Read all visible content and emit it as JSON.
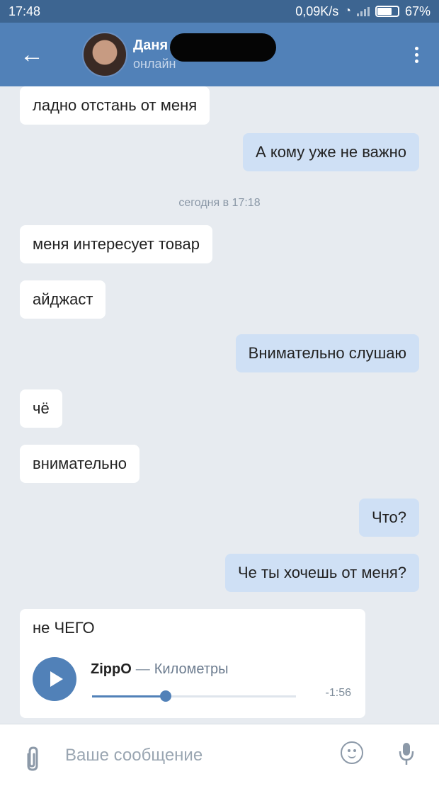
{
  "status_bar": {
    "time": "17:48",
    "network_speed": "0,09K/s",
    "battery_percent": "67%",
    "battery_level": 0.67
  },
  "header": {
    "contact_name": "Даня",
    "contact_status": "онлайн",
    "icons": {
      "back": "back-arrow-icon",
      "menu": "more-vertical-icon"
    }
  },
  "messages": [
    {
      "from": "them",
      "text": "ладно отстань от меня"
    },
    {
      "from": "me",
      "text": "А кому уже не важно"
    },
    {
      "type": "date",
      "text": "сегодня в 17:18"
    },
    {
      "from": "them",
      "text": "меня интересует товар"
    },
    {
      "from": "them",
      "text": "айджаст"
    },
    {
      "from": "me",
      "text": "Внимательно слушаю"
    },
    {
      "from": "them",
      "text": "чё"
    },
    {
      "from": "them",
      "text": "внимательно"
    },
    {
      "from": "me",
      "text": "Что?"
    },
    {
      "from": "me",
      "text": "Че ты хочешь от меня?"
    },
    {
      "from": "them",
      "text": "не ЧЕГО"
    }
  ],
  "attachment": {
    "artist": "ZippO",
    "separator": "—",
    "title": "Километры",
    "time_left": "-1:56",
    "progress": 0.36
  },
  "composer": {
    "placeholder": "Ваше сообщение",
    "icons": {
      "attach": "paperclip-icon",
      "emoji": "smile-icon",
      "voice": "microphone-icon"
    }
  },
  "colors": {
    "header": "#5181b8",
    "status_bar": "#3d6591",
    "outgoing_bubble": "#cfe0f5",
    "incoming_bubble": "#ffffff",
    "background": "#e7ebf0"
  }
}
